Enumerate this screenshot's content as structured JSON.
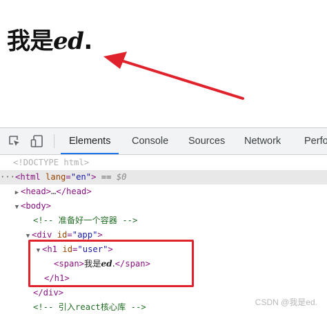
{
  "rendered_page": {
    "heading_prefix": "我是",
    "heading_em": "ed",
    "heading_suffix": "."
  },
  "devtools": {
    "toolbar": {
      "inspect_icon": "inspect-element-icon",
      "device_icon": "device-toolbar-icon",
      "tabs": [
        {
          "label": "Elements",
          "active": true
        },
        {
          "label": "Console",
          "active": false
        },
        {
          "label": "Sources",
          "active": false
        },
        {
          "label": "Network",
          "active": false
        },
        {
          "label": "Perfo",
          "active": false
        }
      ]
    },
    "dom_tree": {
      "doctype": "<!DOCTYPE html>",
      "html_open": "<html",
      "html_lang_attr": "lang",
      "html_lang_val": "\"en\"",
      "html_close_bracket": ">",
      "selected_marker": "== $0",
      "selected_eq": "==",
      "selected_ref": "$0",
      "head_open": "<head>",
      "head_ellipsis": "…",
      "head_close": "</head>",
      "body_open": "<body>",
      "comment_1": "<!-- 准备好一个容器 -->",
      "div_open": "<div",
      "div_id_attr": "id",
      "div_id_val": "\"app\"",
      "div_close_bracket": ">",
      "h1_open": "<h1",
      "h1_id_attr": "id",
      "h1_id_val": "\"user\"",
      "h1_close_bracket": ">",
      "span_open": "<span>",
      "span_text_prefix": "我是",
      "span_text_em": "ed",
      "span_text_suffix": ".",
      "span_close": "</span>",
      "h1_close": "</h1>",
      "div_close": "</div>",
      "comment_2": "<!-- 引入react核心库 -->"
    }
  },
  "watermark": "CSDN @我是ed.",
  "colors": {
    "annotation_red": "#e0222c",
    "tab_active_underline": "#1a73e8",
    "tag": "#881280",
    "attr_name": "#994500",
    "attr_value": "#1a1aa6",
    "comment": "#236e25"
  }
}
